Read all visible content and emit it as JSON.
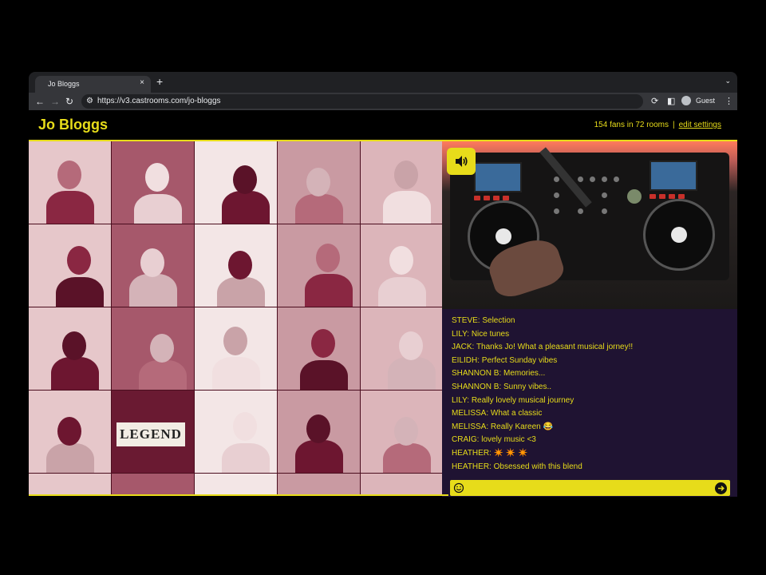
{
  "browser": {
    "tab_title": "Jo Bloggs",
    "tab_close": "×",
    "new_tab": "+",
    "url": "https://v3.castrooms.com/jo-bloggs",
    "profile_label": "Guest"
  },
  "header": {
    "title": "Jo Bloggs",
    "stats": "154 fans in 72 rooms",
    "separator": "|",
    "edit_link": "edit settings"
  },
  "video": {
    "sound_icon": "speaker-icon"
  },
  "grid": {
    "legend_sign": "LEGEND"
  },
  "chat": {
    "messages": [
      "STEVE: Selection",
      "LILY: Nice tunes",
      "JACK: Thanks Jo! What a pleasant musical jorney!!",
      "EILIDH: Perfect Sunday vibes",
      "SHANNON B: Memories...",
      "SHANNON B: Sunny vibes..",
      "LILY: Really lovely musical journey",
      "MELISSA: What a classic",
      "MELISSA: Really Kareen 😂",
      "CRAIG: lovely music <3",
      "HEATHER: ✴️ ✴️ ✴️",
      "HEATHER: Obsessed with this blend"
    ],
    "input_value": "",
    "emoji_icon": "emoji-icon",
    "send_icon": "send-arrow-icon"
  },
  "colors": {
    "accent": "#e7dc1a",
    "chat_background": "#1f1332",
    "grid_tint": "#8a1a3a"
  }
}
